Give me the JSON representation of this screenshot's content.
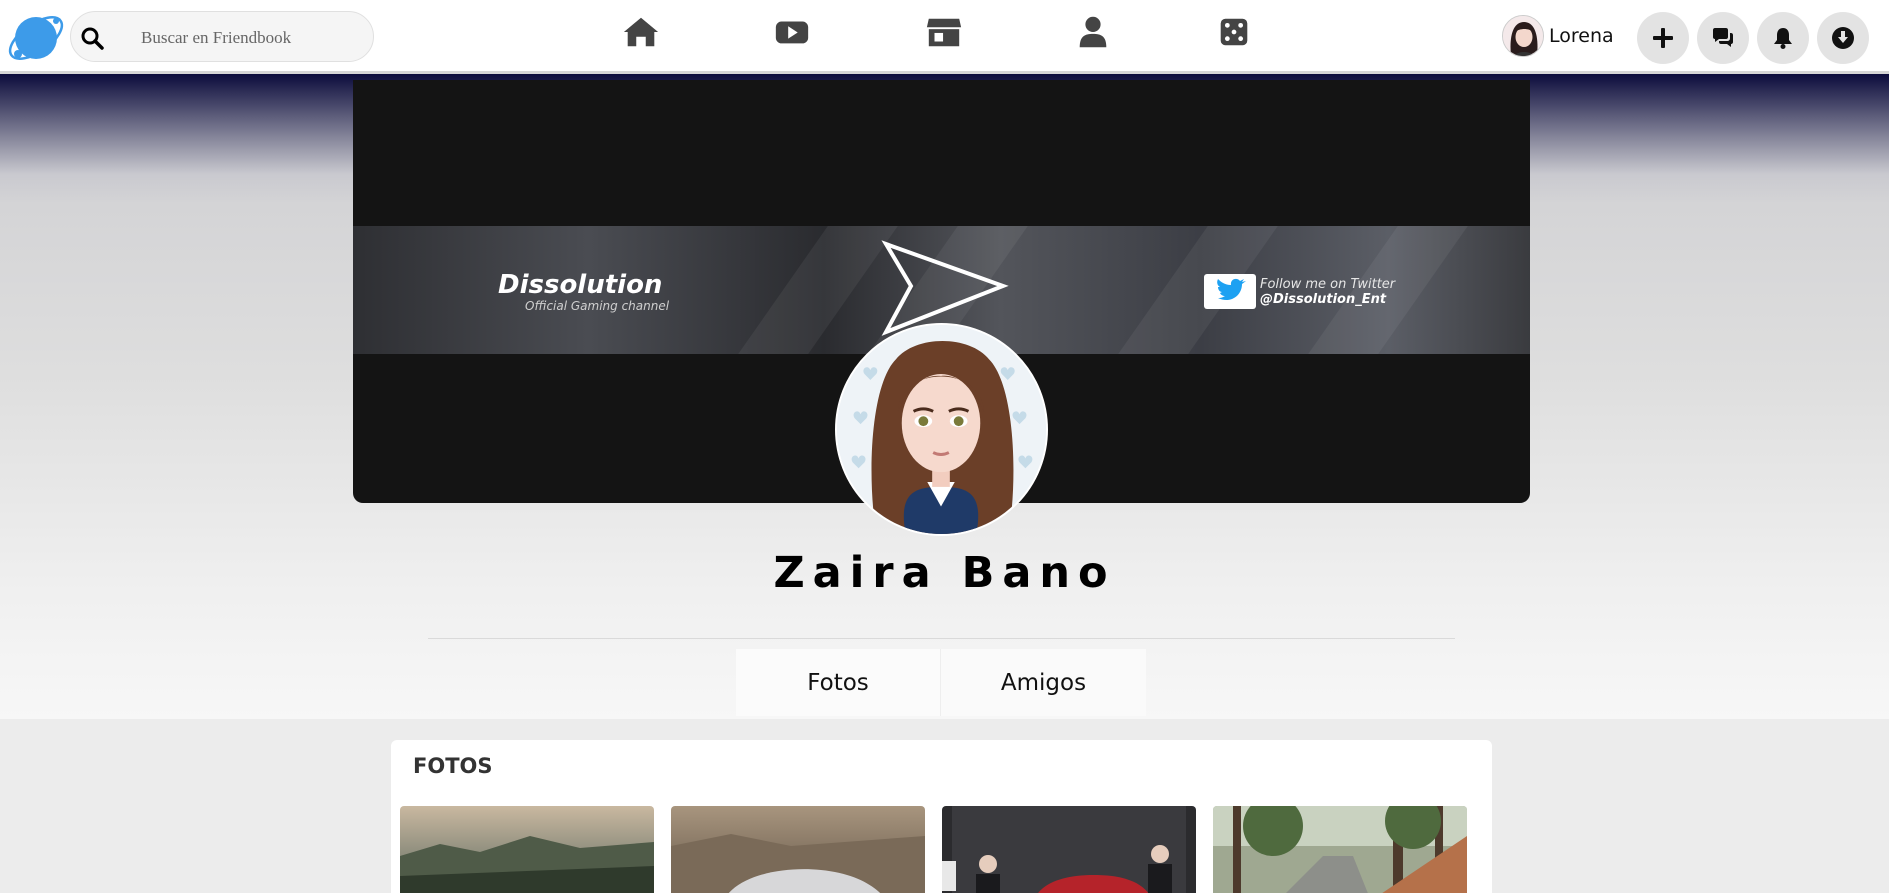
{
  "topbar": {
    "search_placeholder": "Buscar en Friendbook",
    "nav_icons": [
      "home-icon",
      "video-icon",
      "store-icon",
      "profile-icon",
      "dice-icon"
    ],
    "user_name": "Lorena",
    "action_icons": [
      "plus-icon",
      "chat-icon",
      "bell-icon",
      "download-icon"
    ]
  },
  "cover": {
    "brand": "Dissolution",
    "brand_sub": "Official Gaming channel",
    "twitter_line1": "Follow me on Twitter",
    "twitter_line2": "@Dissolution_Ent"
  },
  "profile": {
    "name": "Zaira Bano"
  },
  "tabs": [
    {
      "label": "Fotos",
      "active": true
    },
    {
      "label": "Amigos",
      "active": false
    }
  ],
  "photos": {
    "title": "FOTOS",
    "thumbnails": [
      "car-landscape-photo",
      "silver-car-photo",
      "car-presentation-photo",
      "forest-road-car-photo"
    ]
  },
  "colors": {
    "accent": "#3d9be9",
    "icon": "#444444",
    "header_top": "#0c0c3c"
  }
}
